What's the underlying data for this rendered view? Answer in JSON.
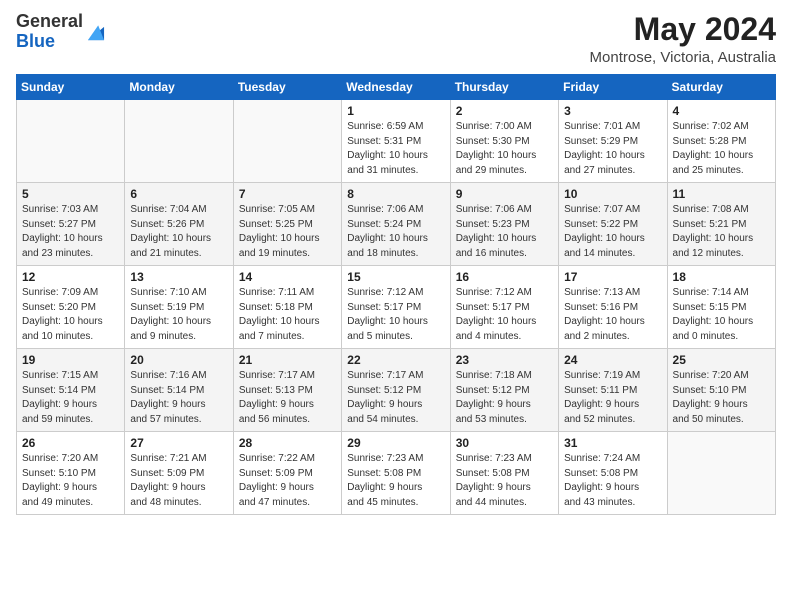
{
  "header": {
    "logo_general": "General",
    "logo_blue": "Blue",
    "month": "May 2024",
    "location": "Montrose, Victoria, Australia"
  },
  "days_of_week": [
    "Sunday",
    "Monday",
    "Tuesday",
    "Wednesday",
    "Thursday",
    "Friday",
    "Saturday"
  ],
  "weeks": [
    [
      {
        "day": "",
        "info": ""
      },
      {
        "day": "",
        "info": ""
      },
      {
        "day": "",
        "info": ""
      },
      {
        "day": "1",
        "info": "Sunrise: 6:59 AM\nSunset: 5:31 PM\nDaylight: 10 hours\nand 31 minutes."
      },
      {
        "day": "2",
        "info": "Sunrise: 7:00 AM\nSunset: 5:30 PM\nDaylight: 10 hours\nand 29 minutes."
      },
      {
        "day": "3",
        "info": "Sunrise: 7:01 AM\nSunset: 5:29 PM\nDaylight: 10 hours\nand 27 minutes."
      },
      {
        "day": "4",
        "info": "Sunrise: 7:02 AM\nSunset: 5:28 PM\nDaylight: 10 hours\nand 25 minutes."
      }
    ],
    [
      {
        "day": "5",
        "info": "Sunrise: 7:03 AM\nSunset: 5:27 PM\nDaylight: 10 hours\nand 23 minutes."
      },
      {
        "day": "6",
        "info": "Sunrise: 7:04 AM\nSunset: 5:26 PM\nDaylight: 10 hours\nand 21 minutes."
      },
      {
        "day": "7",
        "info": "Sunrise: 7:05 AM\nSunset: 5:25 PM\nDaylight: 10 hours\nand 19 minutes."
      },
      {
        "day": "8",
        "info": "Sunrise: 7:06 AM\nSunset: 5:24 PM\nDaylight: 10 hours\nand 18 minutes."
      },
      {
        "day": "9",
        "info": "Sunrise: 7:06 AM\nSunset: 5:23 PM\nDaylight: 10 hours\nand 16 minutes."
      },
      {
        "day": "10",
        "info": "Sunrise: 7:07 AM\nSunset: 5:22 PM\nDaylight: 10 hours\nand 14 minutes."
      },
      {
        "day": "11",
        "info": "Sunrise: 7:08 AM\nSunset: 5:21 PM\nDaylight: 10 hours\nand 12 minutes."
      }
    ],
    [
      {
        "day": "12",
        "info": "Sunrise: 7:09 AM\nSunset: 5:20 PM\nDaylight: 10 hours\nand 10 minutes."
      },
      {
        "day": "13",
        "info": "Sunrise: 7:10 AM\nSunset: 5:19 PM\nDaylight: 10 hours\nand 9 minutes."
      },
      {
        "day": "14",
        "info": "Sunrise: 7:11 AM\nSunset: 5:18 PM\nDaylight: 10 hours\nand 7 minutes."
      },
      {
        "day": "15",
        "info": "Sunrise: 7:12 AM\nSunset: 5:17 PM\nDaylight: 10 hours\nand 5 minutes."
      },
      {
        "day": "16",
        "info": "Sunrise: 7:12 AM\nSunset: 5:17 PM\nDaylight: 10 hours\nand 4 minutes."
      },
      {
        "day": "17",
        "info": "Sunrise: 7:13 AM\nSunset: 5:16 PM\nDaylight: 10 hours\nand 2 minutes."
      },
      {
        "day": "18",
        "info": "Sunrise: 7:14 AM\nSunset: 5:15 PM\nDaylight: 10 hours\nand 0 minutes."
      }
    ],
    [
      {
        "day": "19",
        "info": "Sunrise: 7:15 AM\nSunset: 5:14 PM\nDaylight: 9 hours\nand 59 minutes."
      },
      {
        "day": "20",
        "info": "Sunrise: 7:16 AM\nSunset: 5:14 PM\nDaylight: 9 hours\nand 57 minutes."
      },
      {
        "day": "21",
        "info": "Sunrise: 7:17 AM\nSunset: 5:13 PM\nDaylight: 9 hours\nand 56 minutes."
      },
      {
        "day": "22",
        "info": "Sunrise: 7:17 AM\nSunset: 5:12 PM\nDaylight: 9 hours\nand 54 minutes."
      },
      {
        "day": "23",
        "info": "Sunrise: 7:18 AM\nSunset: 5:12 PM\nDaylight: 9 hours\nand 53 minutes."
      },
      {
        "day": "24",
        "info": "Sunrise: 7:19 AM\nSunset: 5:11 PM\nDaylight: 9 hours\nand 52 minutes."
      },
      {
        "day": "25",
        "info": "Sunrise: 7:20 AM\nSunset: 5:10 PM\nDaylight: 9 hours\nand 50 minutes."
      }
    ],
    [
      {
        "day": "26",
        "info": "Sunrise: 7:20 AM\nSunset: 5:10 PM\nDaylight: 9 hours\nand 49 minutes."
      },
      {
        "day": "27",
        "info": "Sunrise: 7:21 AM\nSunset: 5:09 PM\nDaylight: 9 hours\nand 48 minutes."
      },
      {
        "day": "28",
        "info": "Sunrise: 7:22 AM\nSunset: 5:09 PM\nDaylight: 9 hours\nand 47 minutes."
      },
      {
        "day": "29",
        "info": "Sunrise: 7:23 AM\nSunset: 5:08 PM\nDaylight: 9 hours\nand 45 minutes."
      },
      {
        "day": "30",
        "info": "Sunrise: 7:23 AM\nSunset: 5:08 PM\nDaylight: 9 hours\nand 44 minutes."
      },
      {
        "day": "31",
        "info": "Sunrise: 7:24 AM\nSunset: 5:08 PM\nDaylight: 9 hours\nand 43 minutes."
      },
      {
        "day": "",
        "info": ""
      }
    ]
  ]
}
